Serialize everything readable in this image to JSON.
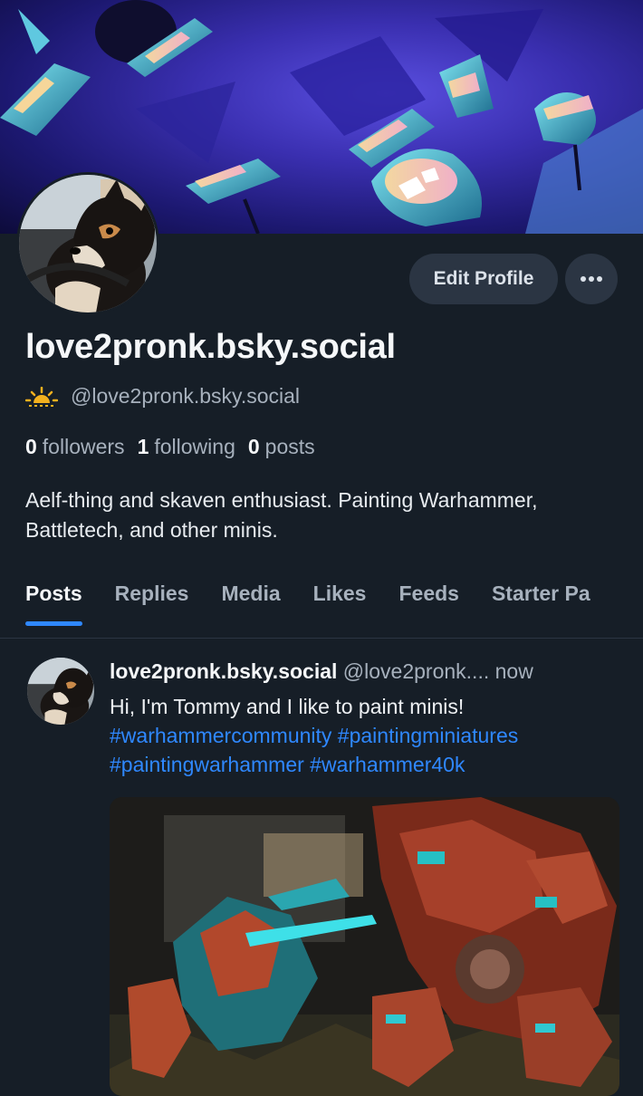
{
  "profile": {
    "display_name": "love2pronk.bsky.social",
    "handle": "@love2pronk.bsky.social",
    "handle_icon": "sun-icon",
    "followers_count": "0",
    "followers_label": "followers",
    "following_count": "1",
    "following_label": "following",
    "posts_count": "0",
    "posts_label": "posts",
    "bio": "Aelf-thing and skaven enthusiast. Painting Warhammer, Battletech, and other minis.",
    "edit_button": "Edit Profile",
    "more_button_icon": "more-dots-icon"
  },
  "tabs": [
    {
      "label": "Posts",
      "active": true
    },
    {
      "label": "Replies",
      "active": false
    },
    {
      "label": "Media",
      "active": false
    },
    {
      "label": "Likes",
      "active": false
    },
    {
      "label": "Feeds",
      "active": false
    },
    {
      "label": "Starter Pa",
      "active": false
    }
  ],
  "post": {
    "author": "love2pronk.bsky.social",
    "handle": "@love2pronk....",
    "time": "now",
    "text": "Hi, I'm Tommy and I like to paint minis!",
    "hashtags": [
      "#warhammercommunity",
      "#paintingminiatures",
      "#paintingwarhammer",
      "#warhammer40k"
    ]
  },
  "colors": {
    "background": "#161e27",
    "accent": "#2f88ff",
    "button_bg": "#2b3543",
    "muted_text": "#a7b1bd",
    "sun_icon": "#f2b01e"
  }
}
